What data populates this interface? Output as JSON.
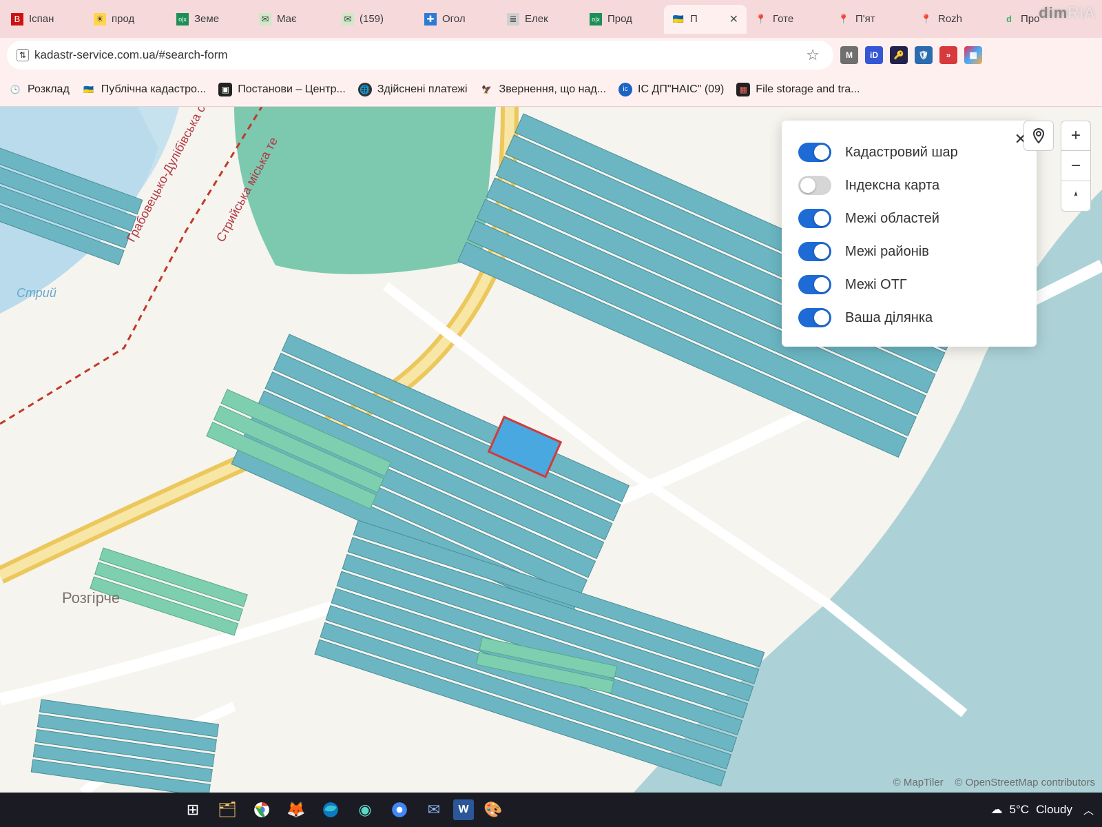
{
  "browser": {
    "tabs": [
      {
        "title": "Іспан",
        "favicon_bg": "#c11",
        "favicon_txt": "В"
      },
      {
        "title": "прод",
        "favicon_bg": "#ffd54a",
        "favicon_txt": "☀"
      },
      {
        "title": "Земе",
        "favicon_bg": "#1b8f57",
        "favicon_txt": "о|х"
      },
      {
        "title": "Має",
        "favicon_bg": "#cfe8c7",
        "favicon_txt": "✉"
      },
      {
        "title": "(159)",
        "favicon_bg": "#cfe8c7",
        "favicon_txt": "✉"
      },
      {
        "title": "Огол",
        "favicon_bg": "#2e7bd6",
        "favicon_txt": "✚"
      },
      {
        "title": "Елек",
        "favicon_bg": "#d0d0d0",
        "favicon_txt": "≣"
      },
      {
        "title": "Прод",
        "favicon_bg": "#1b8f57",
        "favicon_txt": "о|х"
      },
      {
        "title": "П",
        "favicon_bg": "#fff",
        "favicon_txt": "🇺🇦",
        "active": true
      },
      {
        "title": "Готе",
        "favicon_bg": "#fff",
        "favicon_txt": "📍"
      },
      {
        "title": "П'ят",
        "favicon_bg": "#fff",
        "favicon_txt": "📍"
      },
      {
        "title": "Rozh",
        "favicon_bg": "#fff",
        "favicon_txt": "📍"
      },
      {
        "title": "Про",
        "favicon_bg": "#fff",
        "favicon_txt": "d"
      }
    ],
    "url": "kadastr-service.com.ua/#search-form",
    "ext_icons": [
      {
        "bg": "#6f6f6f",
        "txt": "M"
      },
      {
        "bg": "#3557d6",
        "txt": "іD"
      },
      {
        "bg": "#22224c",
        "txt": "🔑"
      },
      {
        "bg": "#2b6cb0",
        "txt": "🛡"
      },
      {
        "bg": "#d63a3a",
        "txt": "»"
      },
      {
        "bg": "linear",
        "txt": "▦"
      }
    ],
    "bookmarks": [
      {
        "icon": "🕒",
        "label": "Розклад"
      },
      {
        "icon": "🇺🇦",
        "label": "Публічна кадастро..."
      },
      {
        "icon": "▣",
        "label": "Постанови – Центр..."
      },
      {
        "icon": "🌐",
        "label": "Здійснені платежі"
      },
      {
        "icon": "🦅",
        "label": "Звернення, що над..."
      },
      {
        "icon": "іс",
        "label": "ІС ДП\"НАІС\" (09)"
      },
      {
        "icon": "▦",
        "label": "File storage and tra..."
      }
    ]
  },
  "map": {
    "layers_panel": {
      "items": [
        {
          "label": "Кадастровий шар",
          "on": true
        },
        {
          "label": "Індексна карта",
          "on": false
        },
        {
          "label": "Межі областей",
          "on": true
        },
        {
          "label": "Межі районів",
          "on": true
        },
        {
          "label": "Межі ОТГ",
          "on": true
        },
        {
          "label": "Ваша ділянка",
          "on": true
        }
      ]
    },
    "labels": {
      "river": "Стрий",
      "town": "Розгірче",
      "boundary1": "Грабовецько-Дулібівська сіл",
      "boundary2": "Стрийська міська те"
    },
    "attribution": {
      "maptiler": "© MapTiler",
      "osm": "© OpenStreetMap contributors"
    }
  },
  "taskbar": {
    "weather": {
      "temp": "5°C",
      "cond": "Cloudy"
    }
  },
  "watermark": {
    "brand": "dim",
    "suffix": "RIA"
  }
}
